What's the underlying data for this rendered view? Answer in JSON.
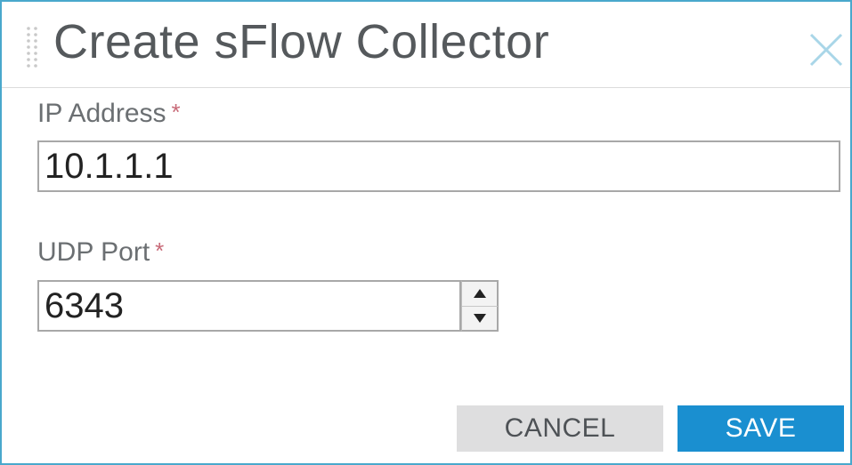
{
  "dialog": {
    "title": "Create sFlow Collector",
    "close_icon": "close-icon",
    "drag_icon": "drag-handle-icon"
  },
  "form": {
    "ip_address": {
      "label": "IP Address",
      "required_mark": "*",
      "value": "10.1.1.1"
    },
    "udp_port": {
      "label": "UDP Port",
      "required_mark": "*",
      "value": "6343",
      "stepper_up_icon": "arrow-up-icon",
      "stepper_down_icon": "arrow-down-icon"
    }
  },
  "buttons": {
    "cancel_label": "CANCEL",
    "save_label": "SAVE"
  },
  "colors": {
    "dialog_border": "#4aa8cc",
    "required_asterisk": "#c86a78",
    "save_button": "#1a8fd0",
    "cancel_button": "#dededf",
    "close_icon": "#a9d6e8"
  }
}
